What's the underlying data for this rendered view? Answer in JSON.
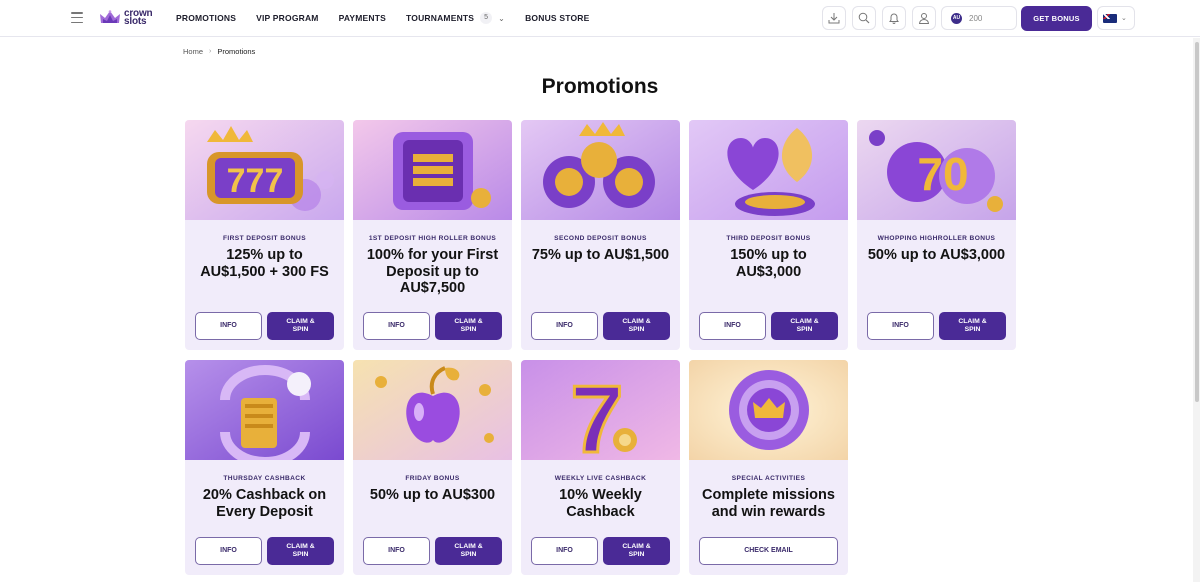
{
  "header": {
    "logo": {
      "line1": "crown",
      "line2": "slots"
    },
    "nav": [
      {
        "label": "PROMOTIONS"
      },
      {
        "label": "VIP PROGRAM"
      },
      {
        "label": "PAYMENTS"
      },
      {
        "label": "TOURNAMENTS",
        "badge": "5"
      },
      {
        "label": "BONUS STORE"
      }
    ],
    "balance": "200",
    "currency_badge": "AU",
    "get_bonus_label": "GET BONUS",
    "icons": [
      "download-icon",
      "search-icon",
      "bell-icon",
      "user-icon"
    ]
  },
  "breadcrumb": {
    "home": "Home",
    "current": "Promotions"
  },
  "page_title": "Promotions",
  "cards": [
    {
      "category": "FIRST DEPOSIT BONUS",
      "title": "125% up to AU$1,500 + 300 FS",
      "info": "INFO",
      "claim": [
        "CLAIM &",
        "SPIN"
      ]
    },
    {
      "category": "1ST DEPOSIT HIGH ROLLER BONUS",
      "title": "100% for your First Deposit up to AU$7,500",
      "info": "INFO",
      "claim": [
        "CLAIM &",
        "SPIN"
      ]
    },
    {
      "category": "SECOND DEPOSIT BONUS",
      "title": "75% up to AU$1,500",
      "info": "INFO",
      "claim": [
        "CLAIM &",
        "SPIN"
      ]
    },
    {
      "category": "THIRD DEPOSIT BONUS",
      "title": "150% up to AU$3,000",
      "info": "INFO",
      "claim": [
        "CLAIM &",
        "SPIN"
      ]
    },
    {
      "category": "WHOPPING HIGHROLLER BONUS",
      "title": "50% up to AU$3,000",
      "info": "INFO",
      "claim": [
        "CLAIM &",
        "SPIN"
      ]
    },
    {
      "category": "THURSDAY CASHBACK",
      "title": "20% Cashback on Every Deposit",
      "info": "INFO",
      "claim": [
        "CLAIM &",
        "SPIN"
      ]
    },
    {
      "category": "FRIDAY BONUS",
      "title": "50% up to AU$300",
      "info": "INFO",
      "claim": [
        "CLAIM &",
        "SPIN"
      ]
    },
    {
      "category": "WEEKLY LIVE CASHBACK",
      "title": "10% Weekly Cashback",
      "info": "INFO",
      "claim": [
        "CLAIM &",
        "SPIN"
      ]
    },
    {
      "category": "SPECIAL ACTIVITIES",
      "title": "Complete missions and win rewards",
      "wide": "CHECK EMAIL"
    }
  ],
  "theme": {
    "accent": "#4a2a96",
    "card_bg": "#f1ecfa",
    "gold": "#e3a82a",
    "purple": "#9a5ce0"
  }
}
